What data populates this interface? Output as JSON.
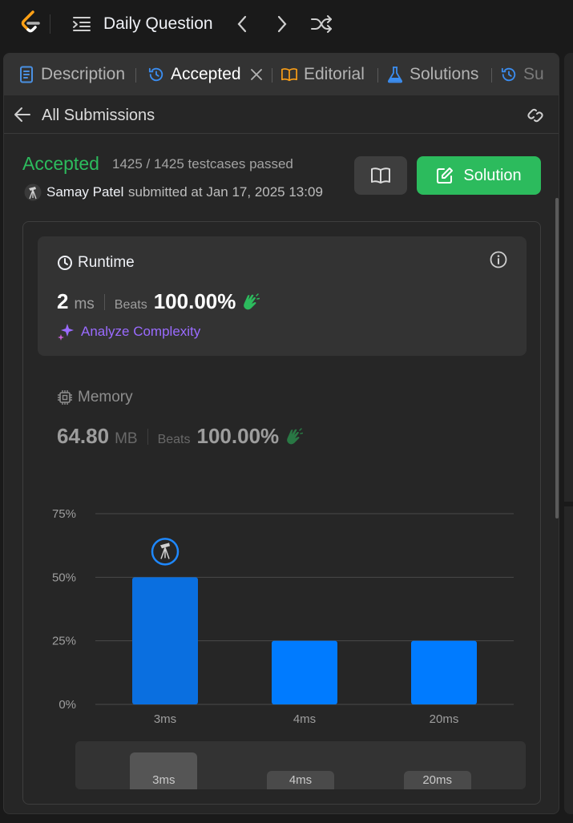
{
  "topnav": {
    "title": "Daily Question"
  },
  "tabs": [
    {
      "label": "Description"
    },
    {
      "label": "Accepted"
    },
    {
      "label": "Editorial"
    },
    {
      "label": "Solutions"
    },
    {
      "label": "Su"
    }
  ],
  "subheader": {
    "back_label": "All Submissions"
  },
  "submission": {
    "status": "Accepted",
    "cases": "1425 / 1425 testcases passed",
    "author": "Samay Patel",
    "submitted": "submitted at Jan 17, 2025 13:09",
    "solution_label": "Solution"
  },
  "runtime": {
    "title": "Runtime",
    "value": "2",
    "unit": "ms",
    "beats_label": "Beats",
    "beats": "100.00%",
    "analyze": "Analyze Complexity"
  },
  "memory": {
    "title": "Memory",
    "value": "64.80",
    "unit": "MB",
    "beats_label": "Beats",
    "beats": "100.00%"
  },
  "colors": {
    "accepted": "#2cbb5d",
    "bar": "#007bff",
    "bar_selected": "#0a6fe0",
    "analyze": "#9a6bff"
  },
  "chart_data": {
    "type": "bar",
    "categories": [
      "3ms",
      "4ms",
      "20ms"
    ],
    "values": [
      50,
      25,
      25
    ],
    "ylim": [
      0,
      75
    ],
    "yticks": [
      "0%",
      "25%",
      "50%",
      "75%"
    ],
    "ytick_values": [
      0,
      25,
      50,
      75
    ],
    "highlight_index": 0,
    "grid": true
  },
  "brush": {
    "categories": [
      "3ms",
      "4ms",
      "20ms"
    ]
  }
}
